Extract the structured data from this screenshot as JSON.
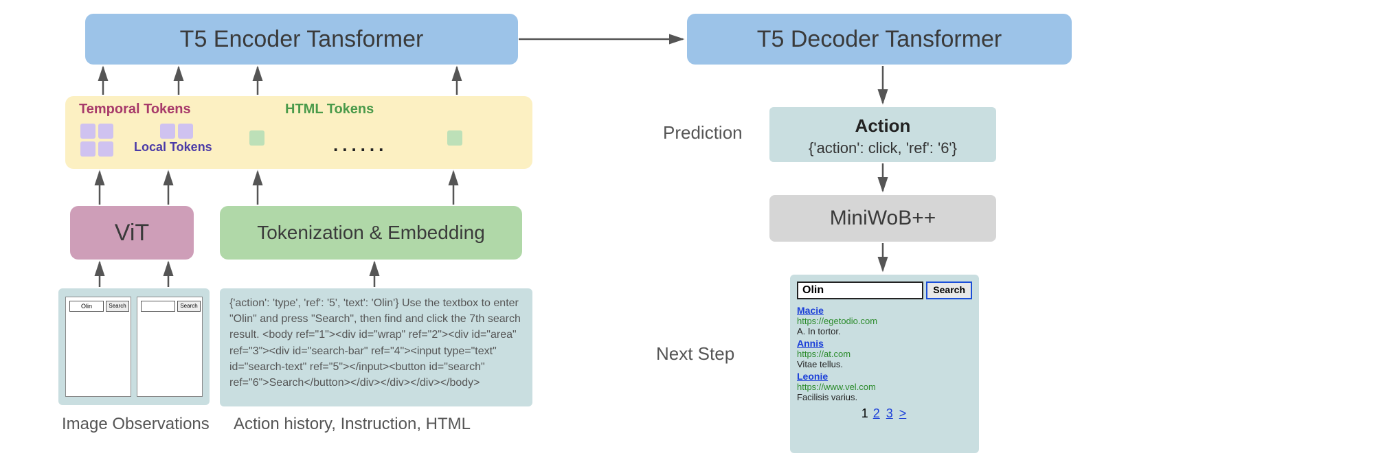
{
  "encoder": {
    "title": "T5 Encoder Tansformer"
  },
  "decoder": {
    "title": "T5 Decoder Tansformer"
  },
  "tokens": {
    "temporal_label": "Temporal Tokens",
    "local_label": "Local Tokens",
    "html_label": "HTML Tokens",
    "dots": "......"
  },
  "vit": {
    "label": "ViT"
  },
  "tokemb": {
    "label": "Tokenization & Embedding"
  },
  "img_obs": {
    "caption": "Image Observations",
    "left_value": "Olin",
    "right_value": "",
    "btn_label": "Search"
  },
  "html_text": {
    "caption": "Action history, Instruction, HTML",
    "body": "{'action': 'type', 'ref': '5', 'text': 'Olin'} Use the textbox to enter \"Olin\" and press \"Search\", then find and click the 7th search result. <body ref=\"1\"><div id=\"wrap\" ref=\"2\"><div id=\"area\" ref=\"3\"><div id=\"search-bar\" ref=\"4\"><input type=\"text\" id=\"search-text\" ref=\"5\"></input><button id=\"search\" ref=\"6\">Search</button></div></div></div></body>"
  },
  "prediction": {
    "label": "Prediction",
    "action_title": "Action",
    "action_body": "{'action': click, 'ref': '6'}"
  },
  "miniwob": {
    "label": "MiniWoB++"
  },
  "nextstep": {
    "label": "Next Step"
  },
  "results": {
    "query": "Olin",
    "search_btn": "Search",
    "items": [
      {
        "title": "Macie",
        "url": "https://egetodio.com",
        "desc": "A. In tortor."
      },
      {
        "title": "Annis",
        "url": "https://at.com",
        "desc": "Vitae tellus."
      },
      {
        "title": "Leonie",
        "url": "https://www.vel.com",
        "desc": "Facilisis varius."
      }
    ],
    "pager": {
      "current": "1",
      "links": [
        "2",
        "3",
        ">"
      ]
    }
  }
}
